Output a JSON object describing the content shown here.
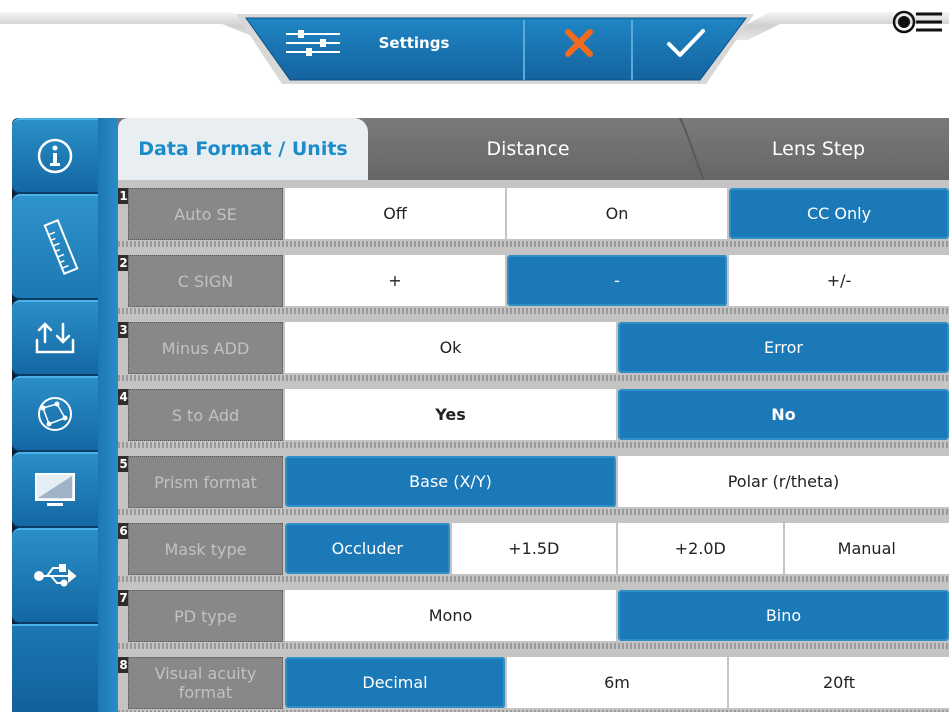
{
  "toolbar": {
    "settings_label": "Settings",
    "settings_icon": "sliders-icon",
    "cancel_icon": "close-icon",
    "confirm_icon": "check-icon",
    "menu_icon": "menu-icon",
    "accent_color": "#1b79b8",
    "cancel_color": "#f26a1b"
  },
  "sidebar": {
    "items": [
      {
        "icon": "info-icon",
        "active": false
      },
      {
        "icon": "ruler-icon",
        "active": true
      },
      {
        "icon": "transfer-icon",
        "active": false
      },
      {
        "icon": "network-icon",
        "active": false
      },
      {
        "icon": "monitor-icon",
        "active": false
      },
      {
        "icon": "usb-icon",
        "active": false
      }
    ]
  },
  "tabs": [
    {
      "label": "Data Format / Units",
      "active": true
    },
    {
      "label": "Distance",
      "active": false
    },
    {
      "label": "Lens Step",
      "active": false
    }
  ],
  "rows": [
    {
      "num": "1",
      "label": "Auto SE",
      "options": [
        "Off",
        "On",
        "CC Only"
      ],
      "selected": 2
    },
    {
      "num": "2",
      "label": "C SIGN",
      "options": [
        "+",
        "-",
        "+/-"
      ],
      "selected": 1
    },
    {
      "num": "3",
      "label": "Minus ADD",
      "options": [
        "Ok",
        "Error"
      ],
      "selected": 1
    },
    {
      "num": "4",
      "label": "S to Add",
      "options": [
        "Yes",
        "No"
      ],
      "selected": 1
    },
    {
      "num": "5",
      "label": "Prism format",
      "options": [
        "Base (X/Y)",
        "Polar (r/theta)"
      ],
      "selected": 0
    },
    {
      "num": "6",
      "label": "Mask type",
      "options": [
        "Occluder",
        "+1.5D",
        "+2.0D",
        "Manual"
      ],
      "selected": 0
    },
    {
      "num": "7",
      "label": "PD type",
      "options": [
        "Mono",
        "Bino"
      ],
      "selected": 1
    },
    {
      "num": "8",
      "label": "Visual acuity format",
      "options": [
        "Decimal",
        "6m",
        "20ft"
      ],
      "selected": 0
    }
  ]
}
